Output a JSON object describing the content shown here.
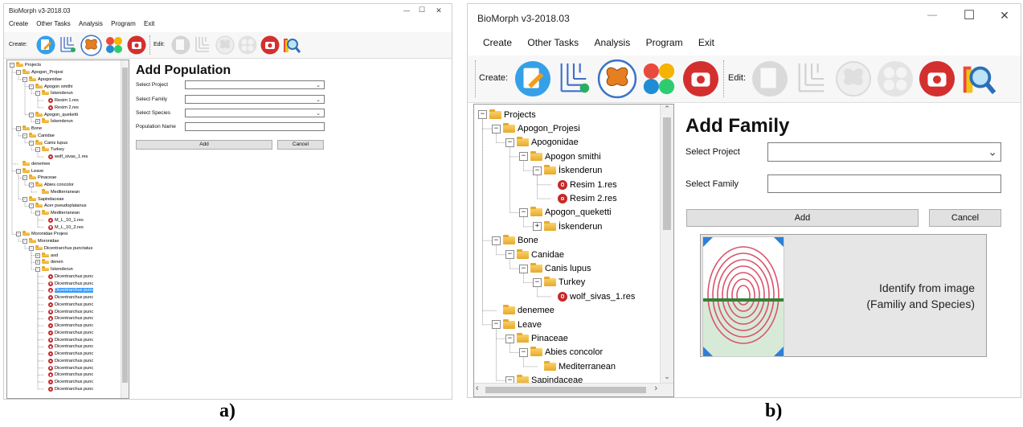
{
  "window_a": {
    "title": "BioMorph v3-2018.03",
    "controls": {
      "minimize": "—",
      "maximize": "☐",
      "close": "✕"
    },
    "menu": [
      "Create",
      "Other Tasks",
      "Analysis",
      "Program",
      "Exit"
    ],
    "toolbar": {
      "create_label": "Create:",
      "edit_label": "Edit:"
    },
    "tree": [
      {
        "text": "Projects",
        "level": 0,
        "icon": "folder",
        "exp": "-"
      },
      {
        "text": "Apogon_Projesi",
        "level": 1,
        "icon": "folder",
        "exp": "-"
      },
      {
        "text": "Apogonidae",
        "level": 2,
        "icon": "folder",
        "exp": "-"
      },
      {
        "text": "Apogon smithi",
        "level": 3,
        "icon": "folder",
        "exp": "-"
      },
      {
        "text": "İskenderun",
        "level": 4,
        "icon": "folder",
        "exp": "-"
      },
      {
        "text": "Resim 1.res",
        "level": 5,
        "icon": "res",
        "exp": ""
      },
      {
        "text": "Resim 2.res",
        "level": 5,
        "icon": "res",
        "exp": ""
      },
      {
        "text": "Apogon_queketti",
        "level": 3,
        "icon": "folder",
        "exp": "-"
      },
      {
        "text": "İskenderun",
        "level": 4,
        "icon": "folder",
        "exp": "+"
      },
      {
        "text": "Bone",
        "level": 1,
        "icon": "folder",
        "exp": "-"
      },
      {
        "text": "Canidae",
        "level": 2,
        "icon": "folder",
        "exp": "-"
      },
      {
        "text": "Canis lupus",
        "level": 3,
        "icon": "folder",
        "exp": "-"
      },
      {
        "text": "Turkey",
        "level": 4,
        "icon": "folder",
        "exp": "-"
      },
      {
        "text": "wolf_sivas_1.res",
        "level": 5,
        "icon": "res",
        "exp": ""
      },
      {
        "text": "denemee",
        "level": 1,
        "icon": "folder",
        "exp": ""
      },
      {
        "text": "Leave",
        "level": 1,
        "icon": "folder",
        "exp": "-"
      },
      {
        "text": "Pinaceae",
        "level": 2,
        "icon": "folder",
        "exp": "-"
      },
      {
        "text": "Abies concolor",
        "level": 3,
        "icon": "folder",
        "exp": "-"
      },
      {
        "text": "Mediterranean",
        "level": 4,
        "icon": "folder",
        "exp": ""
      },
      {
        "text": "Sapindaceae",
        "level": 2,
        "icon": "folder",
        "exp": "-"
      },
      {
        "text": "Acer pseudoplatanus",
        "level": 3,
        "icon": "folder",
        "exp": "-"
      },
      {
        "text": "Mediterranean",
        "level": 4,
        "icon": "folder",
        "exp": "-"
      },
      {
        "text": "M_L_10_1.res",
        "level": 5,
        "icon": "res",
        "exp": ""
      },
      {
        "text": "M_L_10_2.res",
        "level": 5,
        "icon": "res",
        "exp": ""
      },
      {
        "text": "Moronidae Projesi",
        "level": 1,
        "icon": "folder",
        "exp": "-"
      },
      {
        "text": "Moronidae",
        "level": 2,
        "icon": "folder",
        "exp": "-"
      },
      {
        "text": "Dicentrarchus punctatus",
        "level": 3,
        "icon": "folder",
        "exp": "-"
      },
      {
        "text": "asd",
        "level": 4,
        "icon": "folder",
        "exp": "+"
      },
      {
        "text": "denen",
        "level": 4,
        "icon": "folder",
        "exp": "+"
      },
      {
        "text": "İskenderun",
        "level": 4,
        "icon": "folder",
        "exp": "-"
      },
      {
        "text": "Dicentrarchus punc",
        "level": 5,
        "icon": "res",
        "exp": ""
      },
      {
        "text": "Dicentrarchus punc",
        "level": 5,
        "icon": "res",
        "exp": ""
      },
      {
        "text": "Dicentrarchus punc",
        "level": 5,
        "icon": "res",
        "exp": "",
        "selected": true
      },
      {
        "text": "Dicentrarchus punc",
        "level": 5,
        "icon": "res",
        "exp": ""
      },
      {
        "text": "Dicentrarchus punc",
        "level": 5,
        "icon": "res",
        "exp": ""
      },
      {
        "text": "Dicentrarchus punc",
        "level": 5,
        "icon": "res",
        "exp": ""
      },
      {
        "text": "Dicentrarchus punc",
        "level": 5,
        "icon": "res",
        "exp": ""
      },
      {
        "text": "Dicentrarchus punc",
        "level": 5,
        "icon": "res",
        "exp": ""
      },
      {
        "text": "Dicentrarchus punc",
        "level": 5,
        "icon": "res",
        "exp": ""
      },
      {
        "text": "Dicentrarchus punc",
        "level": 5,
        "icon": "res",
        "exp": ""
      },
      {
        "text": "Dicentrarchus punc",
        "level": 5,
        "icon": "res",
        "exp": ""
      },
      {
        "text": "Dicentrarchus punc",
        "level": 5,
        "icon": "res",
        "exp": ""
      },
      {
        "text": "Dicentrarchus punc",
        "level": 5,
        "icon": "res",
        "exp": ""
      },
      {
        "text": "Dicentrarchus punc",
        "level": 5,
        "icon": "res",
        "exp": ""
      },
      {
        "text": "Dicentrarchus punc",
        "level": 5,
        "icon": "res",
        "exp": ""
      },
      {
        "text": "Dicentrarchus punc",
        "level": 5,
        "icon": "res",
        "exp": ""
      },
      {
        "text": "Dicentrarchus punc",
        "level": 5,
        "icon": "res",
        "exp": ""
      }
    ],
    "form": {
      "title": "Add Population",
      "select_project_label": "Select Project",
      "select_family_label": "Select Family",
      "select_species_label": "Select Species",
      "population_name_label": "Population Name",
      "add_label": "Add",
      "cancel_label": "Cancel"
    }
  },
  "window_b": {
    "title": "BioMorph v3-2018.03",
    "controls": {
      "minimize": "—",
      "maximize": "☐",
      "close": "✕"
    },
    "menu": [
      "Create",
      "Other Tasks",
      "Analysis",
      "Program",
      "Exit"
    ],
    "toolbar": {
      "create_label": "Create:",
      "edit_label": "Edit:"
    },
    "tree": [
      {
        "text": "Projects",
        "level": 0,
        "icon": "folder",
        "exp": "-"
      },
      {
        "text": "Apogon_Projesi",
        "level": 1,
        "icon": "folder",
        "exp": "-"
      },
      {
        "text": "Apogonidae",
        "level": 2,
        "icon": "folder",
        "exp": "-"
      },
      {
        "text": "Apogon smithi",
        "level": 3,
        "icon": "folder",
        "exp": "-"
      },
      {
        "text": "İskenderun",
        "level": 4,
        "icon": "folder",
        "exp": "-"
      },
      {
        "text": "Resim 1.res",
        "level": 5,
        "icon": "res",
        "exp": ""
      },
      {
        "text": "Resim 2.res",
        "level": 5,
        "icon": "res",
        "exp": ""
      },
      {
        "text": "Apogon_queketti",
        "level": 3,
        "icon": "folder",
        "exp": "-"
      },
      {
        "text": "İskenderun",
        "level": 4,
        "icon": "folder",
        "exp": "+"
      },
      {
        "text": "Bone",
        "level": 1,
        "icon": "folder",
        "exp": "-"
      },
      {
        "text": "Canidae",
        "level": 2,
        "icon": "folder",
        "exp": "-"
      },
      {
        "text": "Canis lupus",
        "level": 3,
        "icon": "folder",
        "exp": "-"
      },
      {
        "text": "Turkey",
        "level": 4,
        "icon": "folder",
        "exp": "-"
      },
      {
        "text": "wolf_sivas_1.res",
        "level": 5,
        "icon": "res",
        "exp": ""
      },
      {
        "text": "denemee",
        "level": 1,
        "icon": "folder",
        "exp": ""
      },
      {
        "text": "Leave",
        "level": 1,
        "icon": "folder",
        "exp": "-"
      },
      {
        "text": "Pinaceae",
        "level": 2,
        "icon": "folder",
        "exp": "-"
      },
      {
        "text": "Abies concolor",
        "level": 3,
        "icon": "folder",
        "exp": "-"
      },
      {
        "text": "Mediterranean",
        "level": 4,
        "icon": "folder",
        "exp": ""
      },
      {
        "text": "Sapindaceae",
        "level": 2,
        "icon": "folder",
        "exp": "-"
      }
    ],
    "form": {
      "title": "Add Family",
      "select_project_label": "Select Project",
      "select_family_label": "Select Family",
      "add_label": "Add",
      "cancel_label": "Cancel",
      "identify_text_1": "Identify from image",
      "identify_text_2": "(Familiy and Species)"
    }
  },
  "captions": {
    "a": "a)",
    "b": "b)"
  },
  "colors": {
    "selected_bg": "#3399ff",
    "red_icon": "#d32f2f",
    "folder": "#f0b942"
  }
}
